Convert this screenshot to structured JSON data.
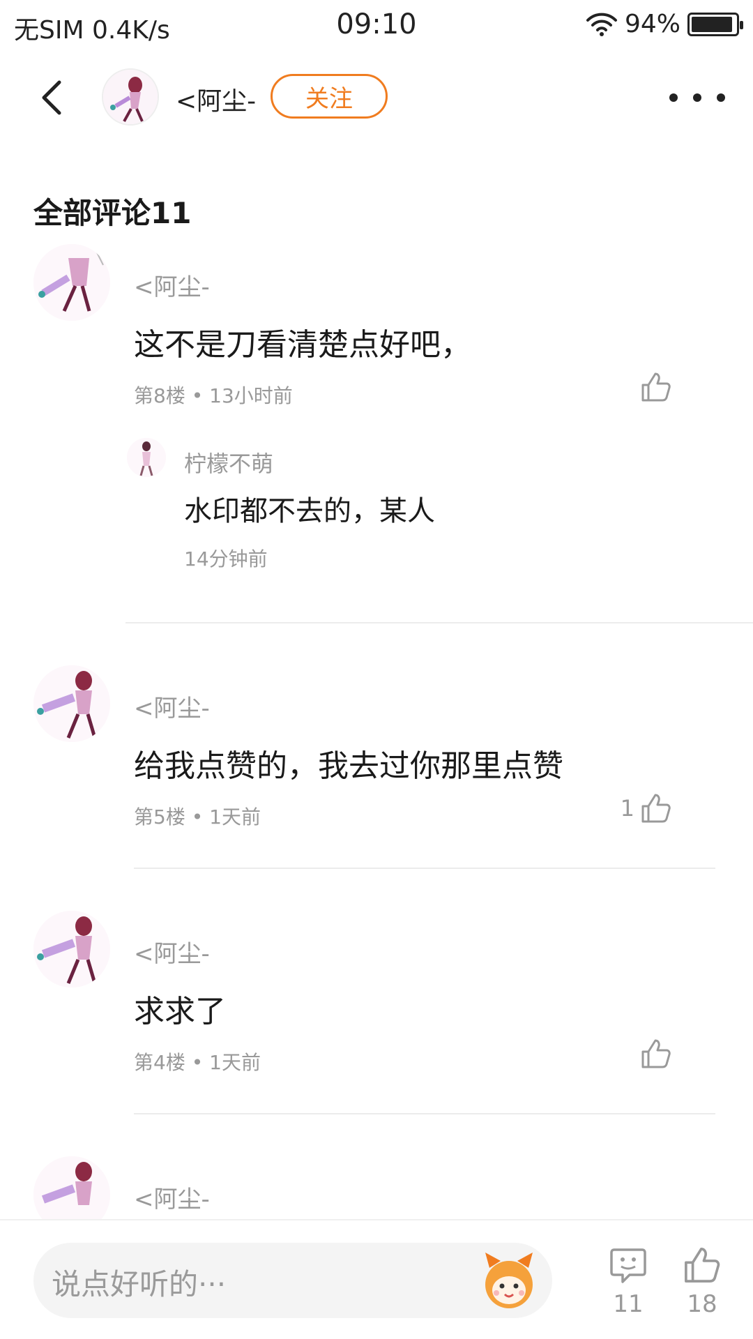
{
  "status_bar": {
    "carrier": "无SIM",
    "speed": "0.4K/s",
    "time": "09:10",
    "battery_text": "94%",
    "battery_level": 0.94
  },
  "header": {
    "author_name": "<阿尘-",
    "follow_label": "关注",
    "back_icon": "chevron-left-icon",
    "more_icon": "more-dots-icon"
  },
  "comments_section": {
    "title": "全部评论11"
  },
  "comments": [
    {
      "author": "<阿尘-",
      "text": "这不是刀看清楚点好吧，",
      "meta": "第8楼 • 13小时前",
      "likes": "",
      "reply": {
        "author": "柠檬不萌",
        "text": "水印都不去的，某人",
        "time": "14分钟前"
      }
    },
    {
      "author": "<阿尘-",
      "text": "给我点赞的，我去过你那里点赞",
      "meta": "第5楼 • 1天前",
      "likes": "1"
    },
    {
      "author": "<阿尘-",
      "text": "求求了",
      "meta": "第4楼 • 1天前",
      "likes": ""
    },
    {
      "author": "<阿尘-"
    }
  ],
  "bottom_bar": {
    "input_placeholder": "说点好听的···",
    "comment_count": "11",
    "like_count": "18"
  },
  "colors": {
    "accent": "#f07c1f",
    "muted_text": "#999999",
    "divider": "#ececec"
  }
}
